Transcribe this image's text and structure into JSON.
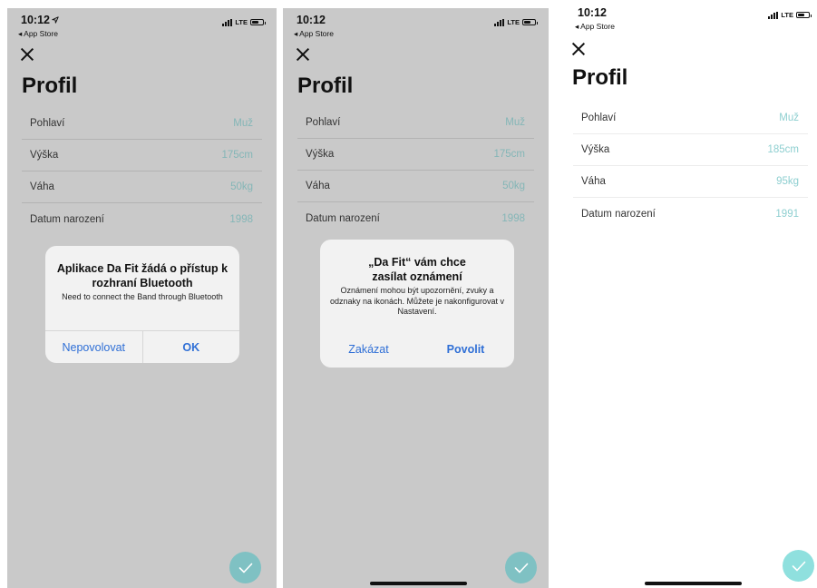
{
  "screens": [
    {
      "status": {
        "time": "10:12",
        "back_label": "◂ App Store",
        "network": "LTE",
        "location_arrow": true
      },
      "title": "Profil",
      "rows": [
        {
          "label": "Pohlaví",
          "value": "Muž"
        },
        {
          "label": "Výška",
          "value": "175cm"
        },
        {
          "label": "Váha",
          "value": "50kg"
        },
        {
          "label": "Datum narození",
          "value": "1998"
        }
      ],
      "dialog": {
        "title": "Aplikace Da Fit žádá o přístup k rozhraní Bluetooth",
        "message": "Need to connect the Band through Bluetooth",
        "buttons": [
          "Nepovolovat",
          "OK"
        ]
      }
    },
    {
      "status": {
        "time": "10:12",
        "back_label": "◂ App Store",
        "network": "LTE"
      },
      "title": "Profil",
      "rows": [
        {
          "label": "Pohlaví",
          "value": "Muž"
        },
        {
          "label": "Výška",
          "value": "175cm"
        },
        {
          "label": "Váha",
          "value": "50kg"
        },
        {
          "label": "Datum narození",
          "value": "1998"
        }
      ],
      "dialog": {
        "title": "„Da Fit“ vám chce zasílat oznámení",
        "message": "Oznámení mohou být upozornění, zvuky a odznaky na ikonách. Můžete je nakonfigurovat v Nastavení.",
        "buttons": [
          "Zakázat",
          "Povolit"
        ]
      }
    },
    {
      "status": {
        "time": "10:12",
        "back_label": "◂ App Store",
        "network": "LTE"
      },
      "title": "Profil",
      "rows": [
        {
          "label": "Pohlaví",
          "value": "Muž"
        },
        {
          "label": "Výška",
          "value": "185cm"
        },
        {
          "label": "Váha",
          "value": "95kg"
        },
        {
          "label": "Datum narození",
          "value": "1991"
        }
      ]
    }
  ],
  "icons": {
    "close": "close-icon",
    "confirm": "checkmark-icon",
    "location": "location-arrow-icon",
    "signal": "signal-bars-icon",
    "battery": "battery-icon"
  },
  "colors": {
    "overlay_background": "#c9c9c9",
    "value_text": "#8ecfd0",
    "fab_accent": "#8fe0de",
    "dialog_button": "#2f6fd6"
  }
}
